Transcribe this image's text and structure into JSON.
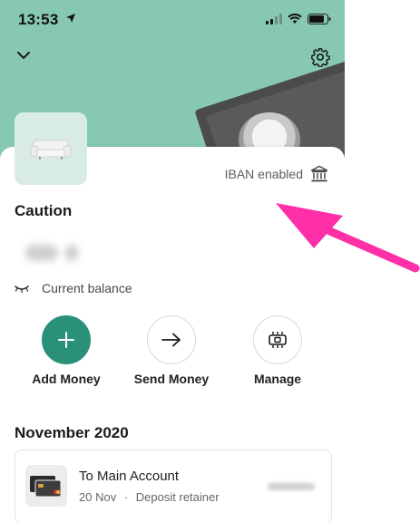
{
  "status_bar": {
    "time": "13:53"
  },
  "account": {
    "iban_label": "IBAN enabled",
    "name": "Caution",
    "balance_label": "Current balance"
  },
  "actions": [
    {
      "label": "Add Money"
    },
    {
      "label": "Send Money"
    },
    {
      "label": "Manage"
    }
  ],
  "transactions": {
    "section_title": "November 2020",
    "items": [
      {
        "title": "To Main Account",
        "date": "20 Nov",
        "separator": "·",
        "note": "Deposit retainer"
      }
    ]
  },
  "colors": {
    "header_bg": "#86c9b0",
    "primary": "#2a9178",
    "annotation_arrow": "#ff2fa8"
  }
}
